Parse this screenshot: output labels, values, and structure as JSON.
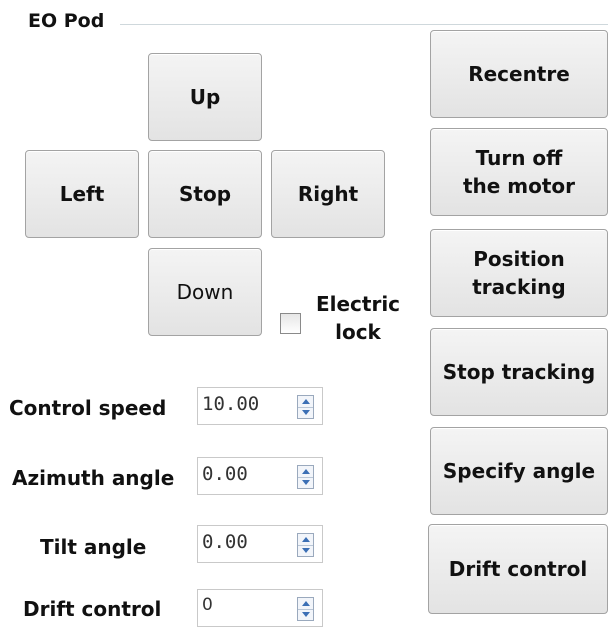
{
  "group": {
    "title": "EO Pod"
  },
  "direction_pad": {
    "up": "Up",
    "left": "Left",
    "stop": "Stop",
    "right": "Right",
    "down": "Down"
  },
  "electric_lock": {
    "label": "Electric\nlock",
    "checked": false
  },
  "fields": [
    {
      "label": "Control speed",
      "value": "10.00"
    },
    {
      "label": "Azimuth angle",
      "value": "0.00"
    },
    {
      "label": "Tilt angle",
      "value": "0.00"
    },
    {
      "label": "Drift control",
      "value": "0"
    }
  ],
  "actions": {
    "recentre": "Recentre",
    "turn_off_motor": "Turn off\nthe motor",
    "position_tracking": "Position\ntracking",
    "stop_tracking": "Stop tracking",
    "specify_angle": "Specify angle",
    "drift_control": "Drift control"
  }
}
